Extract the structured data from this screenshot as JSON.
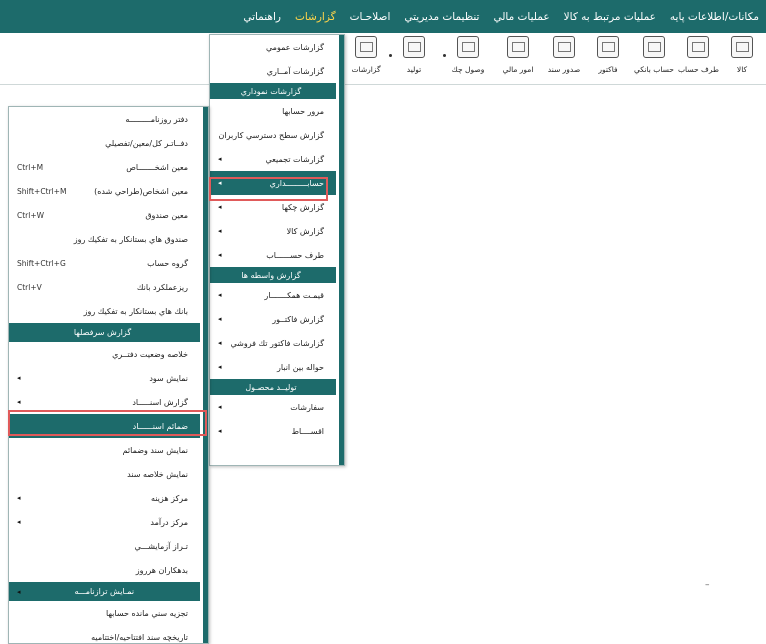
{
  "menubar": {
    "items": [
      "مكانات/اطلاعات پايه",
      "عمليات مرتبط به كالا",
      "عمليات مالي",
      "تنظيمات مديريتي",
      "اصلاحـات",
      "گزارشات",
      "راهنماتي"
    ],
    "active_index": 5
  },
  "toolbar": {
    "items": [
      "كالا",
      "طرف حساب",
      "حساب بانكي",
      "فاكتور",
      "صدور سند",
      "امور مالي",
      "وصول چك",
      "توليد",
      "گزارشات"
    ],
    "icons": [
      "box-icon",
      "person-icon",
      "bank-icon",
      "invoice-icon",
      "document-icon",
      "finance-icon",
      "check-icon",
      "production-icon",
      "reports-icon"
    ]
  },
  "reports_menu": {
    "items": [
      {
        "label": "گزارشات عمومي",
        "type": "item"
      },
      {
        "label": "گزارشات آمــاري",
        "type": "item"
      },
      {
        "label": "گزارشات نموداري",
        "type": "header"
      },
      {
        "label": "مرور حسابها",
        "type": "item"
      },
      {
        "label": "گزارش سطح دسترسي كاربران",
        "type": "item"
      },
      {
        "label": "گزارشات تجميعي",
        "type": "submenu"
      },
      {
        "label": "حسابـــــــــداري",
        "type": "submenu",
        "highlighted": true
      },
      {
        "label": "گزارش چكها",
        "type": "submenu"
      },
      {
        "label": "گزارش كالا",
        "type": "submenu"
      },
      {
        "label": "طرف حســــــاب",
        "type": "submenu"
      },
      {
        "label": "گزارش واسطه ها",
        "type": "header"
      },
      {
        "label": "قيمـت همكـــــــار",
        "type": "submenu"
      },
      {
        "label": "گزارش فاكتــور",
        "type": "submenu"
      },
      {
        "label": "گزارشات فاكتور تك فروشي",
        "type": "submenu"
      },
      {
        "label": "حواله بين انبار",
        "type": "submenu"
      },
      {
        "label": "توليــد محصـول",
        "type": "header"
      },
      {
        "label": "سفارشات",
        "type": "submenu"
      },
      {
        "label": "اقســــاط",
        "type": "submenu"
      }
    ]
  },
  "accounting_menu": {
    "items": [
      {
        "label": "دفتر روزنامـــــــــه",
        "type": "item",
        "shortcut": ""
      },
      {
        "label": "دفــاتـر كل/معين/تفصيلي",
        "type": "item",
        "shortcut": ""
      },
      {
        "label": "معين اشخـــــــاص",
        "type": "item",
        "shortcut": "Ctrl+M"
      },
      {
        "label": "معين اشخاص(طراحي شده)",
        "type": "item",
        "shortcut": "Shift+Ctrl+M"
      },
      {
        "label": "معين صندوق",
        "type": "item",
        "shortcut": "Ctrl+W"
      },
      {
        "label": "صندوق هاي بستانكار به تفكيك روز",
        "type": "item",
        "shortcut": ""
      },
      {
        "label": "گروه حساب",
        "type": "item",
        "shortcut": "Shift+Ctrl+G"
      },
      {
        "label": "ريزعملكرد بانك",
        "type": "item",
        "shortcut": "Ctrl+V"
      },
      {
        "label": "بانك هاي بستانكار به تفكيك روز",
        "type": "item",
        "shortcut": ""
      },
      {
        "label": "گزارش سرفصلها",
        "type": "header",
        "shortcut": ""
      },
      {
        "label": "خلاصه وضعيت دفتــري",
        "type": "item",
        "shortcut": ""
      },
      {
        "label": "نمايش سود",
        "type": "submenu",
        "shortcut": ""
      },
      {
        "label": "گزارش اسنـــــاد",
        "type": "submenu",
        "shortcut": ""
      },
      {
        "label": "ضمائم اسنــــــاد",
        "type": "item",
        "shortcut": "",
        "highlighted": true
      },
      {
        "label": "نمايش سند وضمائم",
        "type": "item",
        "shortcut": ""
      },
      {
        "label": "نمايش خلاصه سند",
        "type": "item",
        "shortcut": ""
      },
      {
        "label": "مركز هزينه",
        "type": "submenu",
        "shortcut": ""
      },
      {
        "label": "مركز درآمد",
        "type": "submenu",
        "shortcut": ""
      },
      {
        "label": "تـراز آزمايشـــي",
        "type": "item",
        "shortcut": ""
      },
      {
        "label": "بدهكاران هرروز",
        "type": "item",
        "shortcut": ""
      },
      {
        "label": "نمـايش ترازنامـــه",
        "type": "header",
        "shortcut": ""
      },
      {
        "label": "تجزيه سني مانده حسابها",
        "type": "item",
        "shortcut": ""
      },
      {
        "label": "تاريخچه سند افتتاحيه/اختتاميه",
        "type": "item",
        "shortcut": ""
      }
    ]
  },
  "stray_mark": "–"
}
